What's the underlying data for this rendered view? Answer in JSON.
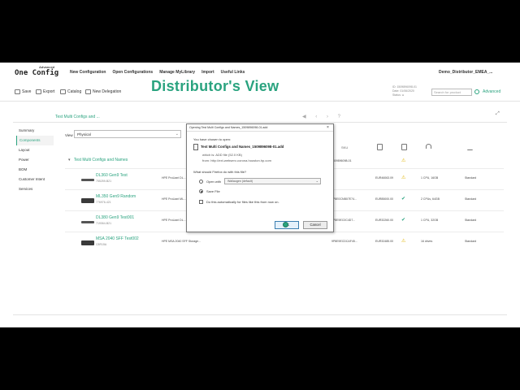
{
  "app": {
    "logo_sup": "Advanced",
    "logo_main": "One Config"
  },
  "nav": {
    "items": [
      "New Configuration",
      "Open Configurations",
      "Manage MyLibrary",
      "Import",
      "Useful Links"
    ],
    "user": "Demo_Distributor_EMEA_..."
  },
  "toolbar": {
    "save": "Save",
    "export": "Export",
    "catalog": "Catalog",
    "new_delegation": "New Delegation",
    "banner": "Distributor's View",
    "info_lines": [
      "ID: 1509896098-01",
      "Date: 01/06/2020",
      "Status: ●"
    ],
    "search_placeholder": "Search for product",
    "advanced": "Advanced"
  },
  "config": {
    "title": "Test Multi Configs and ...",
    "pager": "◀ ‹ › ?",
    "expand": "⤢"
  },
  "sidebar": {
    "items": [
      "Summary",
      "Components",
      "Layout",
      "Power",
      "BOM",
      "Customer Intent",
      "Services"
    ],
    "active_index": 1
  },
  "view": {
    "label": "View",
    "value": "Physical"
  },
  "table": {
    "sku_header": "SKU",
    "group_label": "Test Multi Configs and Names",
    "group_part": "1509896098-01",
    "rows": [
      {
        "name": "DL360 Gen9 Test",
        "sku": "755259-B21",
        "desc": "HPE ProLiant DL...",
        "part": "",
        "price": "EUR46063.09",
        "status": "⚠",
        "spec": "1 CPU, 16GB",
        "support": "Standard",
        "img": "flat"
      },
      {
        "name": "ML350 Gen9 Random",
        "sku": "776976-421",
        "desc": "HPE ProLiant ML...",
        "part": "8P8E0CNB07E74...",
        "price": "EUR85000.00",
        "status": "✔",
        "spec": "2 CPUs, 64GB",
        "support": "Standard",
        "img": "tower"
      },
      {
        "name": "DL380 Gen9 Test001",
        "sku": "719064-B21",
        "desc": "HPE ProLiant DL...",
        "part": "8P8E9EC0C4D7...",
        "price": "EUR32260.00",
        "status": "✔",
        "spec": "1 CPU, 32GB",
        "support": "Standard",
        "img": "flat"
      },
      {
        "name": "MSA 2040 SFF Test002",
        "sku": "C8R15A",
        "desc": "HPE MSA 2040 SFF Storage...",
        "part": "9P8E9ECDCAF45...",
        "price": "EUR32485.00",
        "status": "⚠",
        "spec": "16 drives",
        "support": "Standard",
        "img": "tower"
      }
    ]
  },
  "dialog": {
    "title": "Opening Test Multi Configs and Names_1509896098-01.add",
    "close": "×",
    "intro": "You have chosen to open:",
    "filename": "Test Multi Configs and Names_1509896098-01.add",
    "which_is": "which is: ADD file (52.0 KB)",
    "from": "from: http://ext-webserv-corona.houston.hp.com",
    "question": "What should Firefox do with this file?",
    "open_with_label": "Open with",
    "open_with_value": "Wallaugen (default)",
    "save_file_label": "Save File",
    "auto_label": "Do this automatically for files like this from now on.",
    "ok": "OK",
    "cancel": "Cancel"
  }
}
